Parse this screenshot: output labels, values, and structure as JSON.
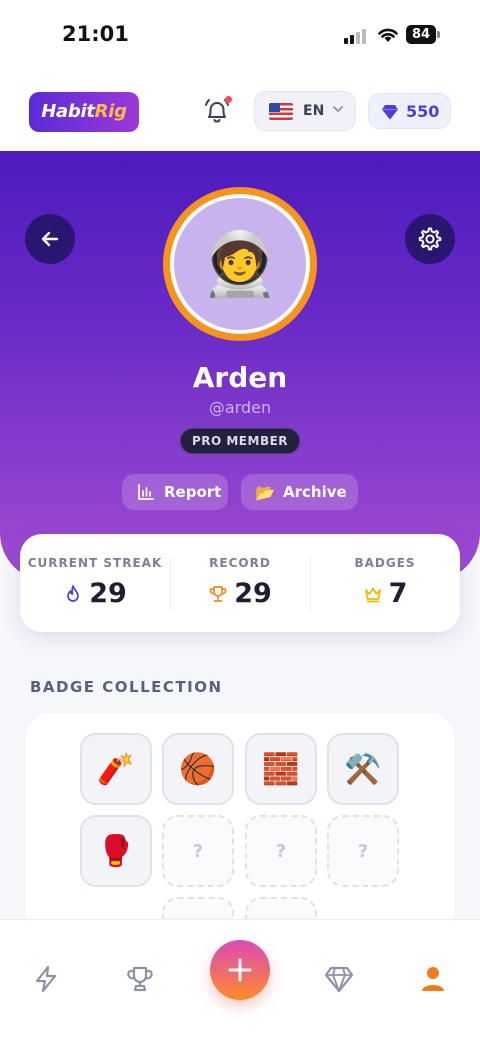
{
  "status_bar": {
    "time": "21:01",
    "battery": "84"
  },
  "app_bar": {
    "logo_part1": "Habit",
    "logo_part2": "Rig",
    "language": {
      "flag": "us-flag",
      "code": "EN"
    },
    "gems": {
      "count": "550",
      "icon": "diamond-icon"
    },
    "notification_dot_color": "#ff4757"
  },
  "profile": {
    "avatar_emoji": "🧑‍🚀",
    "name": "Arden",
    "handle": "@arden",
    "membership": "PRO MEMBER",
    "actions": [
      {
        "label": "Report",
        "icon": "bar-chart-icon"
      },
      {
        "label": "Archive",
        "icon": "📂"
      }
    ]
  },
  "stats": [
    {
      "label": "CURRENT STREAK",
      "value": "29",
      "icon": "flame-icon",
      "color": "#4b3fd8"
    },
    {
      "label": "RECORD",
      "value": "29",
      "icon": "trophy-icon",
      "color": "#f08a1c"
    },
    {
      "label": "BADGES",
      "value": "7",
      "icon": "crown-icon",
      "color": "#f2b705"
    }
  ],
  "badge_collection": {
    "title": "BADGE COLLECTION",
    "badges": [
      {
        "emoji": "🧨",
        "earned": true
      },
      {
        "emoji": "🏀",
        "earned": true
      },
      {
        "emoji": "🧱",
        "earned": true
      },
      {
        "emoji": "⚒️",
        "earned": true
      },
      {
        "emoji": "🥊",
        "earned": true
      },
      {
        "emoji": "?",
        "earned": false
      },
      {
        "emoji": "?",
        "earned": false
      },
      {
        "emoji": "?",
        "earned": false
      }
    ]
  },
  "bottom_nav": {
    "items": [
      "lightning-icon",
      "trophy-icon",
      "plus-icon",
      "diamond-icon",
      "profile-icon"
    ],
    "active": "profile-icon",
    "active_color": "#f07c1e",
    "inactive_color": "#8d93a5"
  },
  "colors": {
    "brand_purple": "#5b2bd6",
    "accent_orange": "#f7941d"
  }
}
